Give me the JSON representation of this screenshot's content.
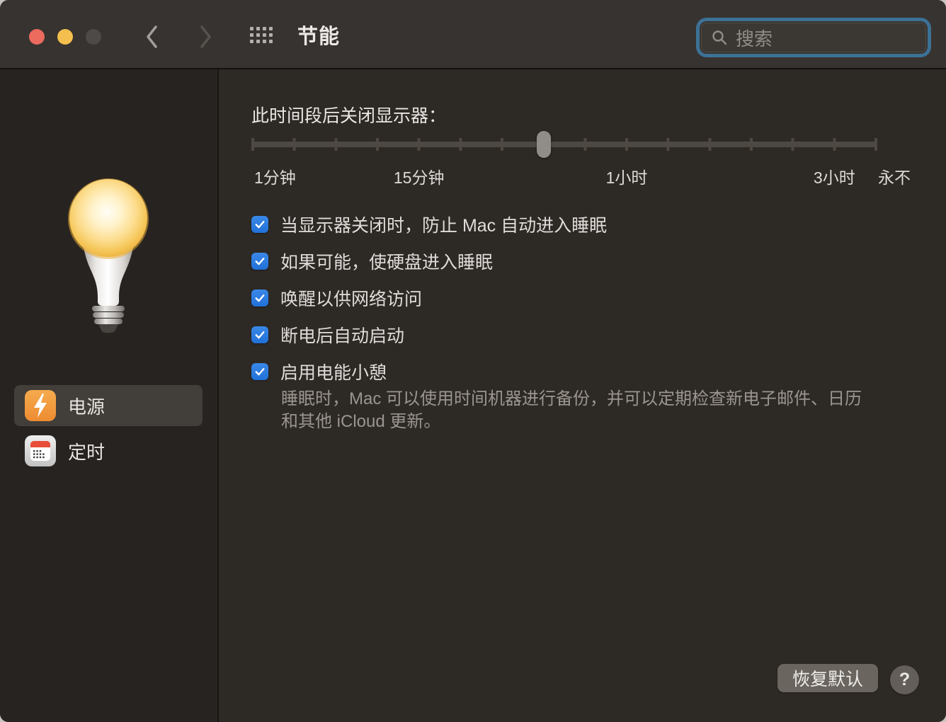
{
  "window": {
    "title": "节能"
  },
  "titlebar": {
    "traffic_lights": {
      "close": "#ec6a5e",
      "minimize": "#f4bf4e",
      "zoom_disabled": "#4e4a47"
    },
    "search": {
      "placeholder": "搜索"
    }
  },
  "sidebar": {
    "items": [
      {
        "label": "电源",
        "selected": true,
        "icon": "power-bolt-icon"
      },
      {
        "label": "定时",
        "selected": false,
        "icon": "schedule-calendar-icon"
      }
    ]
  },
  "main": {
    "display_sleep": {
      "label": "此时间段后关闭显示器：",
      "tick_labels": {
        "0": "1分钟",
        "1": "15分钟",
        "2": "1小时",
        "3": "3小时",
        "4": "永不"
      },
      "tick_count": 16,
      "thumb_tick_index": 7
    },
    "checkboxes": [
      {
        "label": "当显示器关闭时，防止 Mac 自动进入睡眠",
        "checked": true
      },
      {
        "label": "如果可能，使硬盘进入睡眠",
        "checked": true
      },
      {
        "label": "唤醒以供网络访问",
        "checked": true
      },
      {
        "label": "断电后自动启动",
        "checked": true
      },
      {
        "label": "启用电能小憩",
        "checked": true
      }
    ],
    "power_nap_description": "睡眠时，Mac 可以使用时间机器进行备份，并可以定期检查新电子邮件、日历和其他 iCloud 更新。",
    "restore_defaults_label": "恢复默认",
    "help_label": "?"
  },
  "colors": {
    "titlebar_bg": "#373330",
    "sidebar_bg": "#272320",
    "main_bg": "#2d2925",
    "checkbox_blue": "#2e7ce0",
    "focus_ring": "#3d7195",
    "selected_item_bg": "#423e3a"
  }
}
